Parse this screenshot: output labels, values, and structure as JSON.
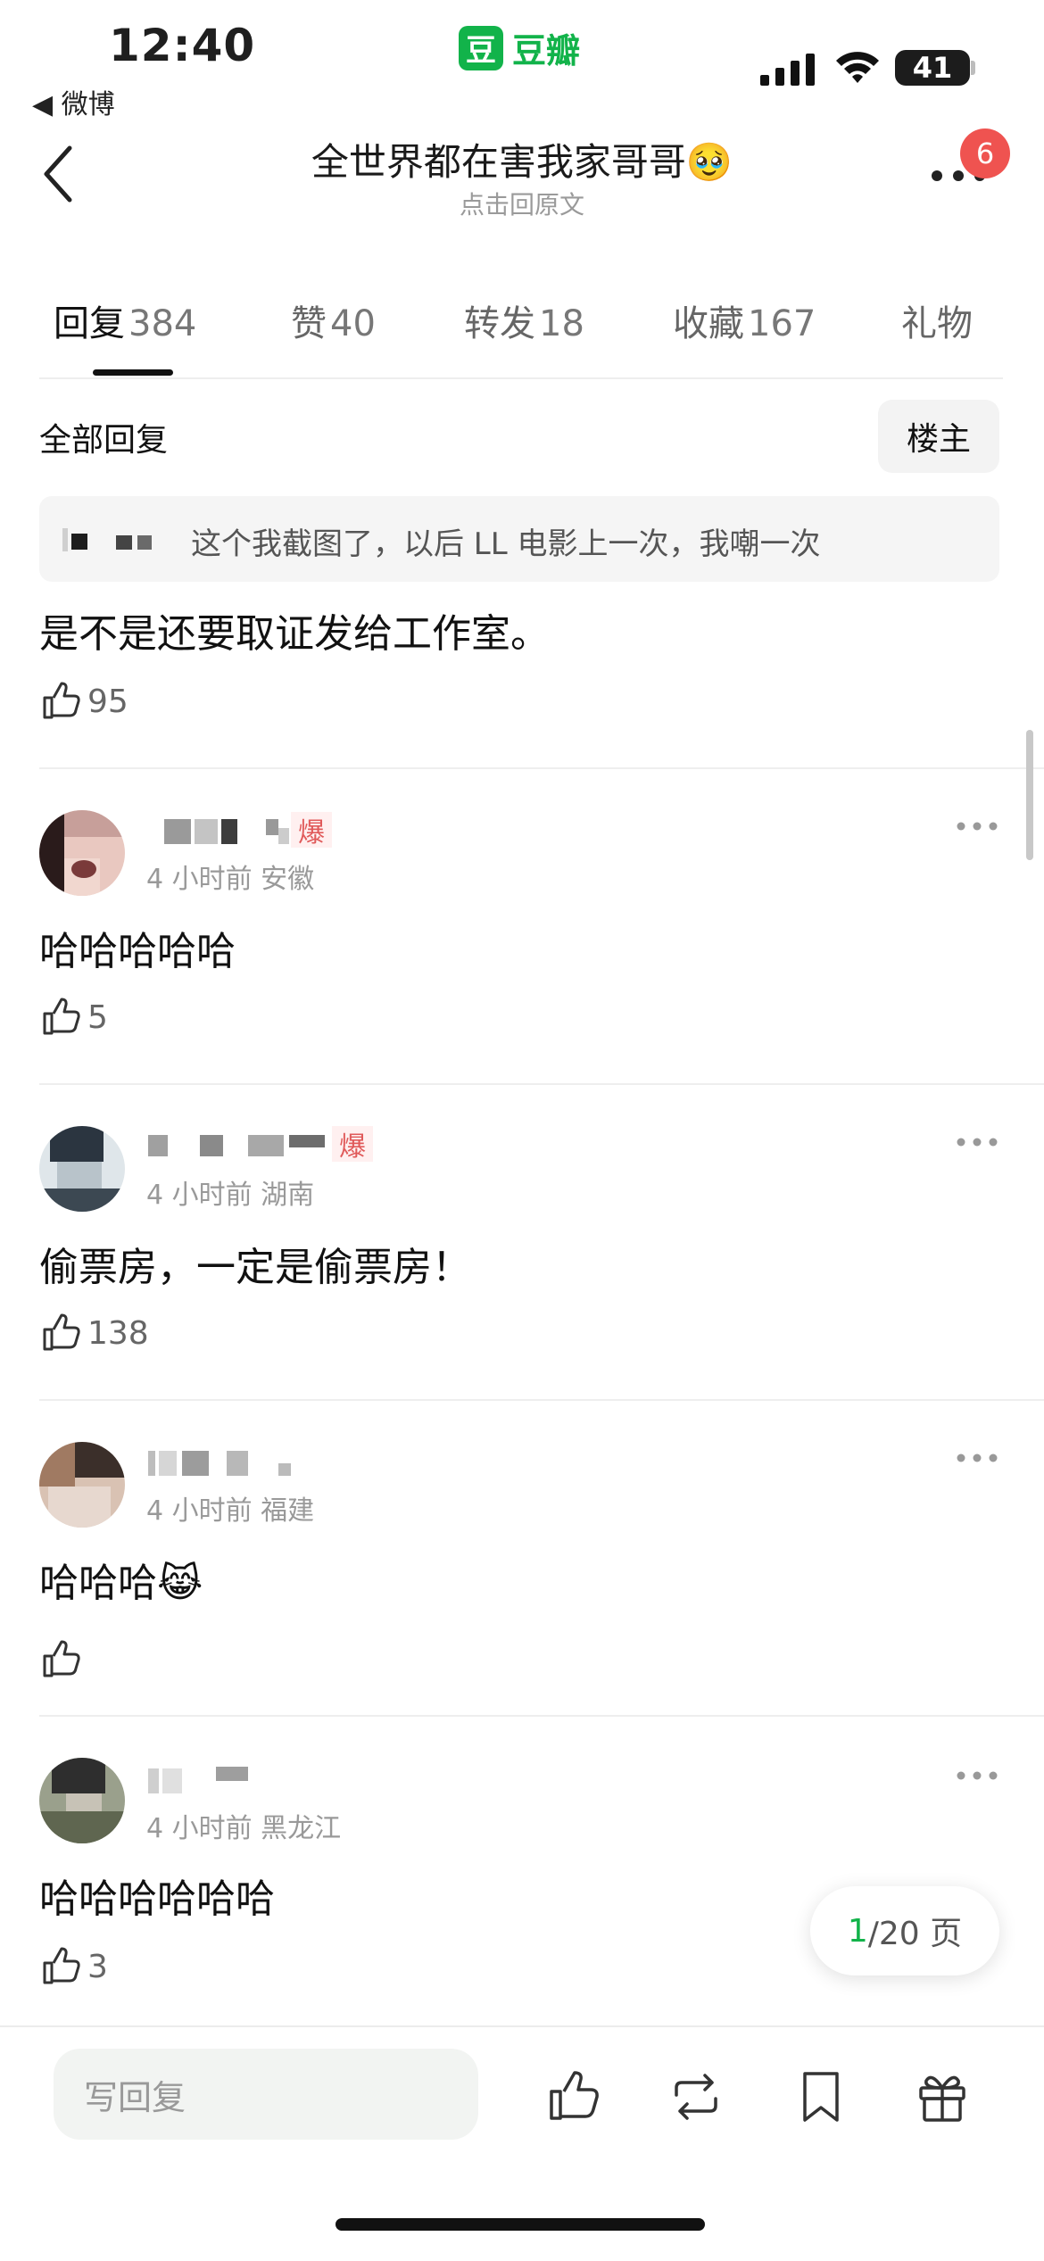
{
  "status_bar": {
    "time": "12:40",
    "back_app": "◀ 微博",
    "brand_logo_char": "豆",
    "brand": "豆瓣",
    "battery": "41"
  },
  "header": {
    "title": "全世界都在害我家哥哥🥹",
    "subtitle": "点击回原文",
    "badge": "6"
  },
  "tabs": [
    {
      "label": "回复",
      "count": "384",
      "active": true
    },
    {
      "label": "赞",
      "count": "40"
    },
    {
      "label": "转发",
      "count": "18"
    },
    {
      "label": "收藏",
      "count": "167"
    },
    {
      "label": "礼物",
      "count": ""
    }
  ],
  "filter": {
    "all_label": "全部回复",
    "owner_label": "楼主"
  },
  "first_reply": {
    "quote": "这个我截图了，以后 LL 电影上一次，我嘲一次",
    "content": "是不是还要取证发给工作室。",
    "likes": "95"
  },
  "comments": [
    {
      "tag": "爆",
      "meta": "4 小时前 安徽",
      "content": "哈哈哈哈哈",
      "likes": "5"
    },
    {
      "tag": "爆",
      "meta": "4 小时前 湖南",
      "content": "偷票房，一定是偷票房！",
      "likes": "138"
    },
    {
      "tag": "",
      "meta": "4 小时前 福建",
      "content": "哈哈哈😹",
      "likes": ""
    },
    {
      "tag": "",
      "meta": "4 小时前 黑龙江",
      "content": "哈哈哈哈哈哈",
      "likes": "3"
    }
  ],
  "pagination": {
    "current": "1",
    "total": "/20 页"
  },
  "bottom_bar": {
    "reply_placeholder": "写回复"
  },
  "colors": {
    "brand_green": "#12b34a",
    "badge_red": "#ef5350",
    "tag_red": "#e05a5a"
  }
}
